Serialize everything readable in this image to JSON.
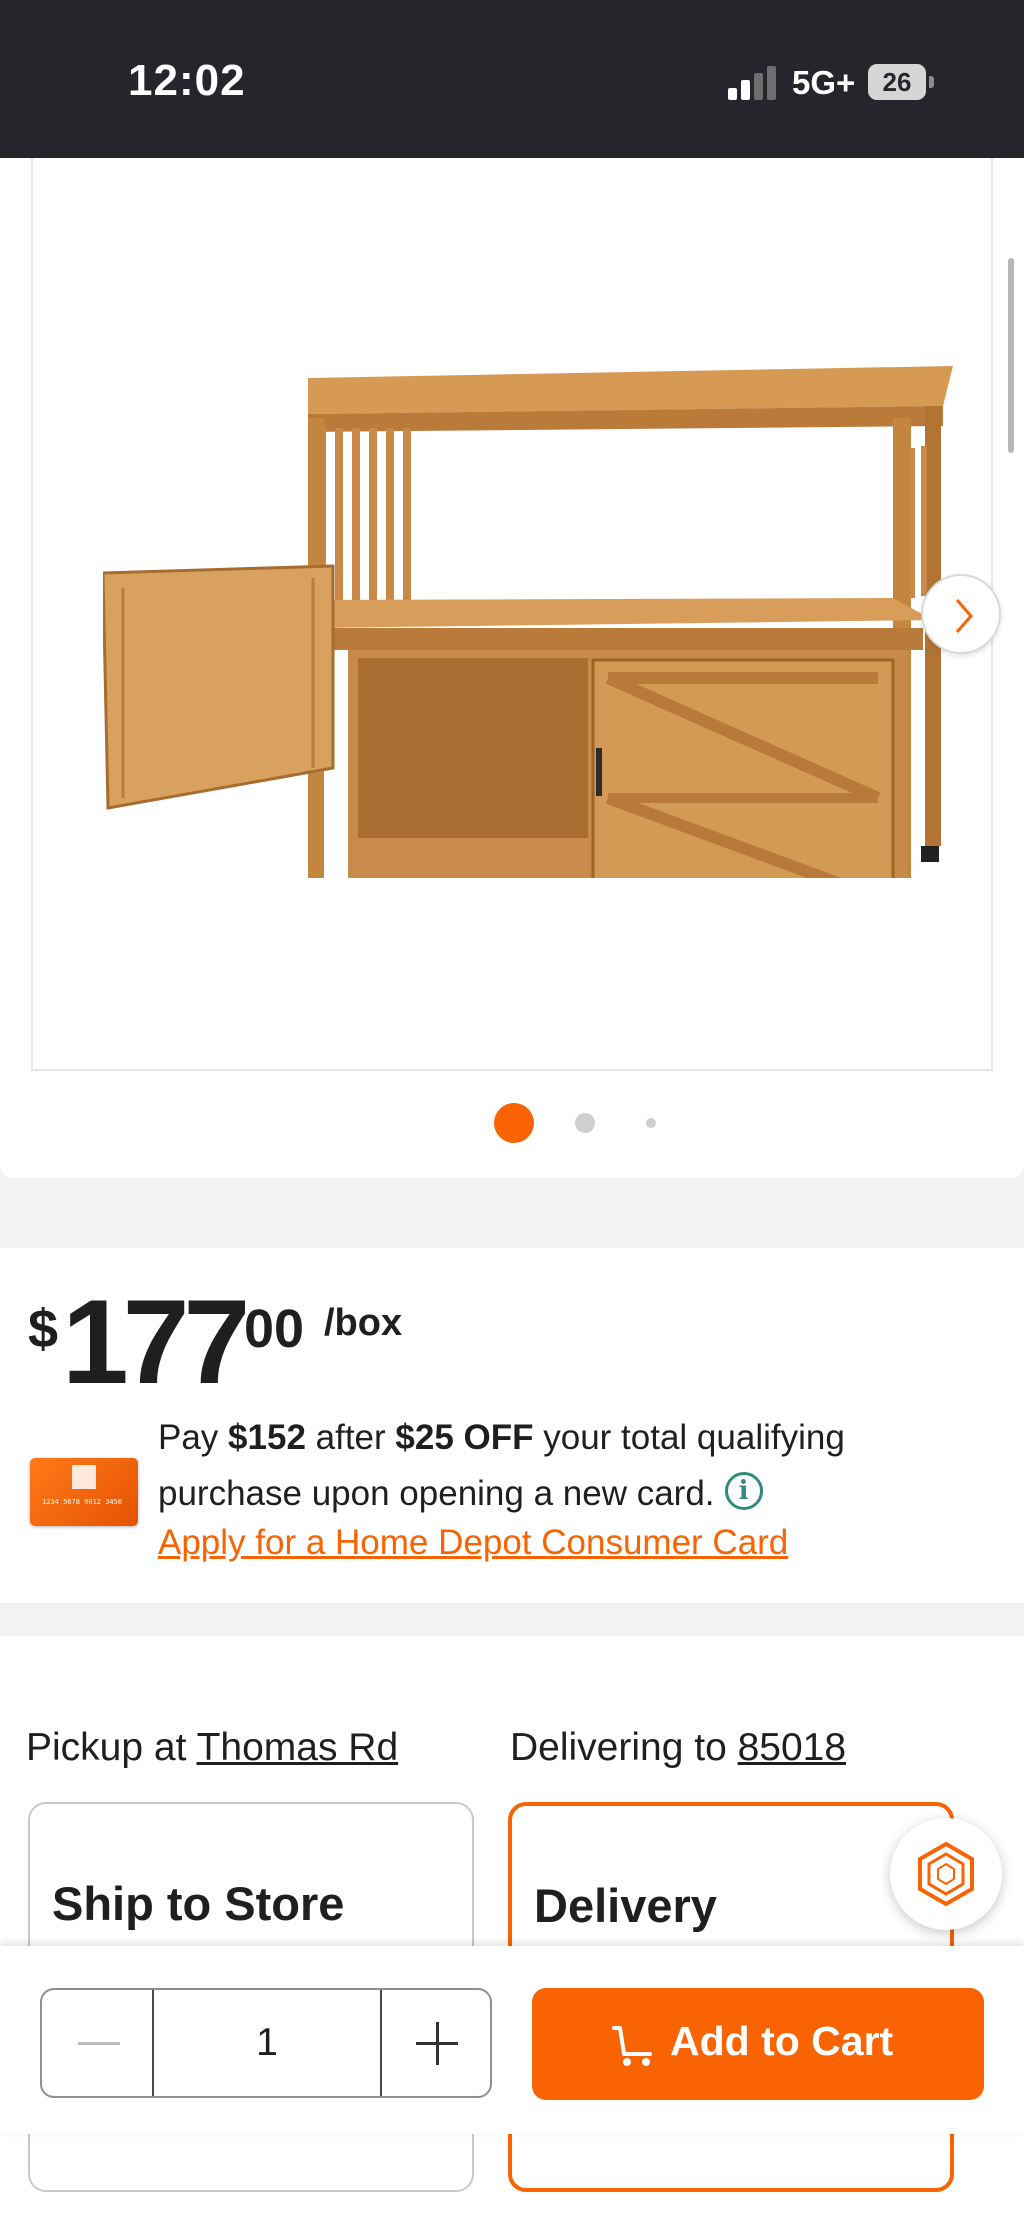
{
  "status_bar": {
    "time": "12:02",
    "network": "5G+",
    "battery": "26"
  },
  "gallery": {
    "image": "wooden-potting-bench-cabinet",
    "slide_count": 3,
    "active_slide": 1,
    "next_icon": "chevron-right-icon"
  },
  "price": {
    "currency": "$",
    "dollars": "177",
    "cents": "00",
    "unit": "/box"
  },
  "promo": {
    "pay_prefix": "Pay ",
    "pay_amount": "$152",
    "after_text": " after ",
    "discount": "$25 OFF",
    "rest": " your total qualifying purchase upon opening a new card.",
    "info_icon": "i",
    "apply_link": "Apply for a Home Depot Consumer Card"
  },
  "fulfillment": {
    "pickup_prefix": "Pickup at ",
    "pickup_store": "Thomas Rd",
    "delivering_prefix": "Delivering to ",
    "delivering_zip": "85018",
    "ship_to_store": "Ship to Store",
    "delivery": "Delivery"
  },
  "cart": {
    "quantity": "1",
    "add_to_cart": "Add to Cart"
  },
  "colors": {
    "brand_orange": "#f96302",
    "status_bar": "#25262b",
    "info_teal": "#2f8b7e"
  }
}
